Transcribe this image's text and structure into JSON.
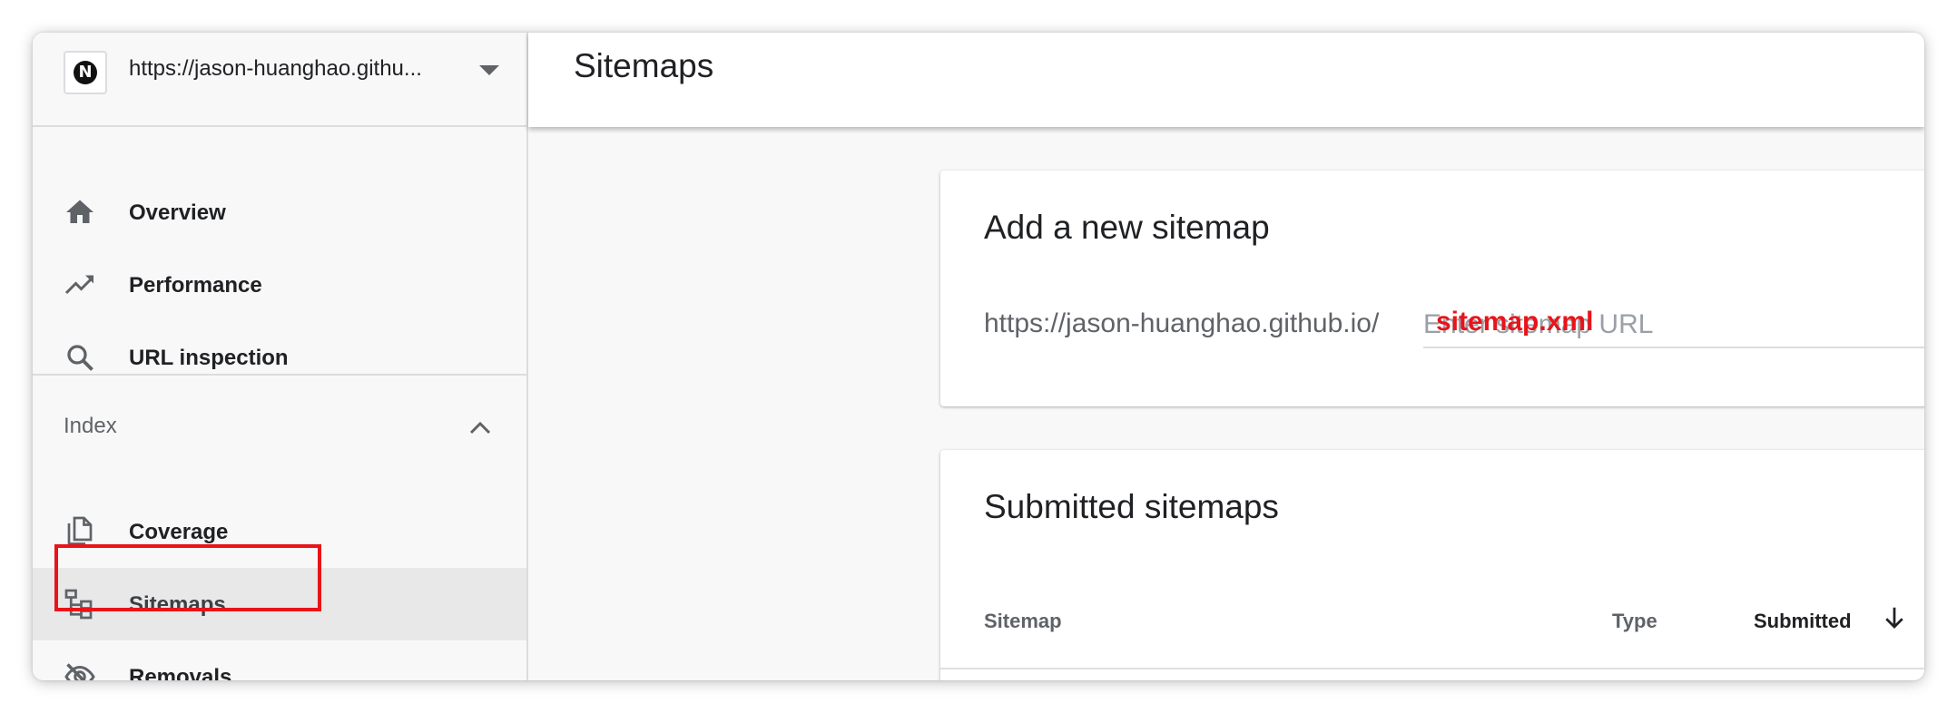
{
  "property": {
    "url": "https://jason-huanghao.githu...",
    "favicon_letter": "N"
  },
  "sidebar": {
    "items": [
      {
        "label": "Overview",
        "icon": "home-icon"
      },
      {
        "label": "Performance",
        "icon": "trending-up-icon"
      },
      {
        "label": "URL inspection",
        "icon": "search-icon"
      }
    ],
    "index_section": {
      "label": "Index",
      "expanded": true,
      "items": [
        {
          "label": "Coverage",
          "icon": "file-copy-icon"
        },
        {
          "label": "Sitemaps",
          "icon": "sitemap-icon",
          "active": true
        },
        {
          "label": "Removals",
          "icon": "visibility-off-icon"
        }
      ]
    }
  },
  "header": {
    "title": "Sitemaps"
  },
  "add_sitemap": {
    "title": "Add a new sitemap",
    "url_prefix": "https://jason-huanghao.github.io/",
    "placeholder": "Enter sitemap URL",
    "typed_value": "sitemap.xml"
  },
  "submitted": {
    "title": "Submitted sitemaps",
    "columns": [
      "Sitemap",
      "Type",
      "Submitted"
    ],
    "sort_column": "Submitted",
    "sort_direction": "descending"
  },
  "colors": {
    "annotation_red": "#e8141a",
    "active_bg": "#e8e8e8"
  }
}
